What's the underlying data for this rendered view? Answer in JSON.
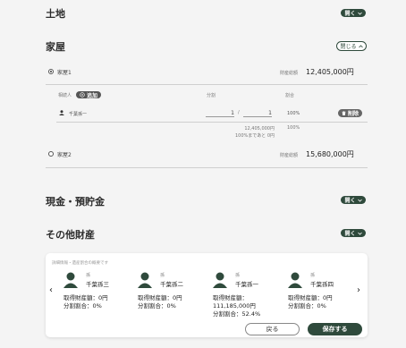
{
  "sections": {
    "land": {
      "title": "土地",
      "toggle": "開く"
    },
    "house": {
      "title": "家屋",
      "toggle": "閉じる"
    },
    "cash": {
      "title": "現金・預貯金",
      "toggle": "開く"
    },
    "other": {
      "title": "その他財産",
      "toggle": "開く"
    }
  },
  "house1": {
    "name": "家屋1",
    "total_label": "財産総額",
    "total_value": "12,405,000円",
    "col_heir": "相続人",
    "add_label": "追加",
    "col_share": "分割",
    "col_ratio": "割合",
    "row": {
      "name": "千葉孫一",
      "numerator": "1",
      "slash": "/",
      "denominator": "1",
      "ratio": "100%",
      "delete_label": "削除"
    },
    "summary_amount": "12,405,000円",
    "summary_ratio_value": "100%",
    "summary_note": "100%まであと 0円"
  },
  "house2": {
    "name": "家屋2",
    "total_label": "財産総額",
    "total_value": "15,680,000円"
  },
  "summary_card": {
    "caption": "詳細情報・遺産割合の概要です",
    "heirs": [
      {
        "relation": "孫",
        "name": "千葉孫三",
        "amount": "取得財産額：0円",
        "ratio": "分割割合：0%"
      },
      {
        "relation": "孫",
        "name": "千葉孫二",
        "amount": "取得財産額：0円",
        "ratio": "分割割合：0%"
      },
      {
        "relation": "孫",
        "name": "千葉孫一",
        "amount": "取得財産額：",
        "amount2": "111,185,000円",
        "ratio": "分割割合：52.4%"
      },
      {
        "relation": "孫",
        "name": "千葉孫四",
        "amount": "取得財産額：0円",
        "ratio": "分割割合：0%"
      }
    ],
    "prev": "‹",
    "next": "›"
  },
  "buttons": {
    "back": "戻る",
    "save": "保存する"
  },
  "colors": {
    "accent": "#2f4a3c",
    "background": "#f4f4f4"
  }
}
